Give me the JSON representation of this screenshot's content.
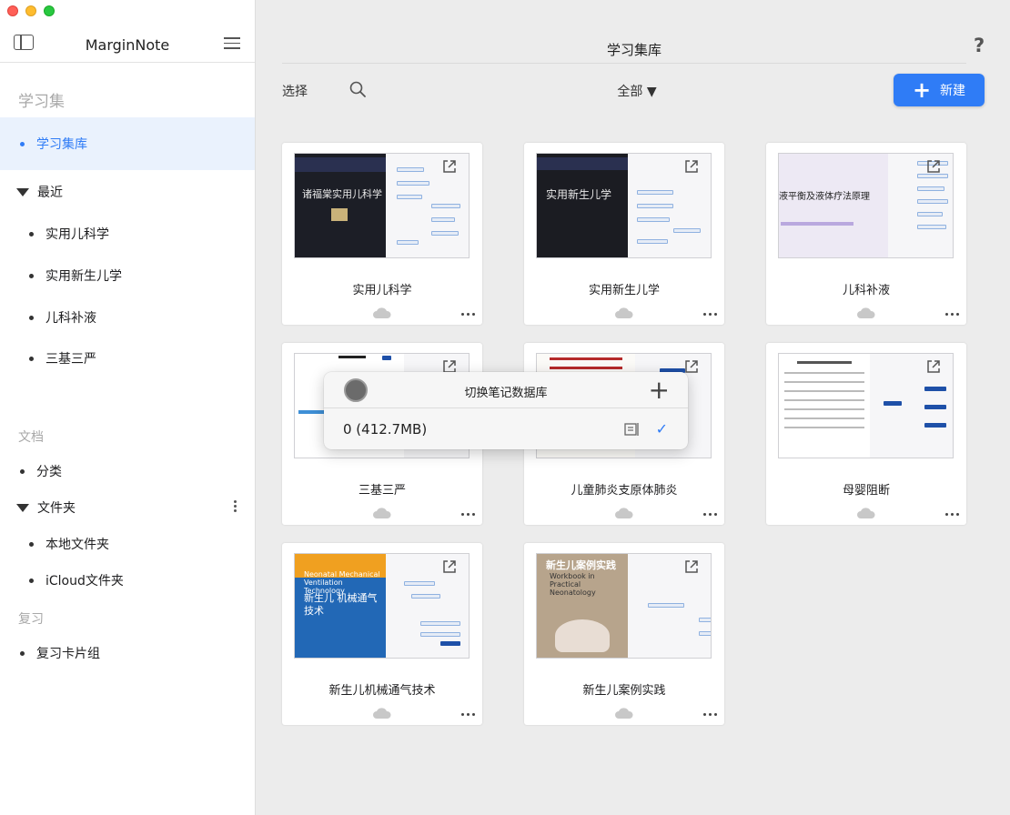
{
  "sidebar": {
    "app_title": "MarginNote",
    "study_sets_title": "学习集",
    "library_item": "学习集库",
    "recent_title": "最近",
    "recent_items": [
      "实用儿科学",
      "实用新生儿学",
      "儿科补液",
      "三基三严"
    ],
    "documents_title": "文档",
    "category_item": "分类",
    "folders_title": "文件夹",
    "local_folder": "本地文件夹",
    "icloud_folder": "iCloud文件夹",
    "review_title": "复习",
    "card_deck": "复习卡片组"
  },
  "main": {
    "title": "学习集库",
    "select_label": "选择",
    "filter_label": "全部 ▼",
    "new_label": "新建",
    "help_label": "?"
  },
  "cards": [
    {
      "title": "实用儿科学",
      "cover_text": "诸福棠实用儿科学"
    },
    {
      "title": "实用新生儿学",
      "cover_text": "实用新生儿学"
    },
    {
      "title": "儿科补液",
      "cover_text": "液平衡及液体疗法原理"
    },
    {
      "title": "三基三严",
      "cover_text": ""
    },
    {
      "title": "儿童肺炎支原体肺炎",
      "cover_text": ""
    },
    {
      "title": "母婴阻断",
      "cover_text": ""
    },
    {
      "title": "新生儿机械通气技术",
      "cover_text": "新生儿 机械通气技术",
      "cover_text_en": "Neonatal Mechanical Ventilation Technology"
    },
    {
      "title": "新生儿案例实践",
      "cover_text": "新生儿案例实践",
      "cover_text_en": "Workbook in Practical Neonatology"
    }
  ],
  "popover": {
    "title": "切换笔记数据库",
    "add_label": "+",
    "row_label": "0  (412.7MB)",
    "check": "✓"
  },
  "colors": {
    "accent": "#2f7cf6",
    "sidebar_selected_bg": "#eaf2fd",
    "main_bg": "#ececec"
  }
}
